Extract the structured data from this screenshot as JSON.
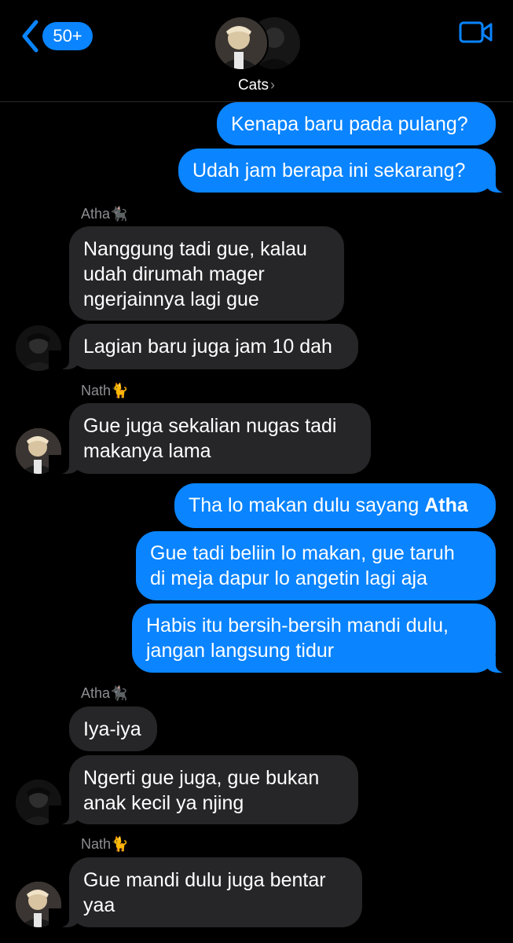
{
  "header": {
    "back_badge": "50+",
    "group_name": "Cats",
    "group_arrow": "›"
  },
  "messages": [
    {
      "type": "outgoing",
      "text": "Kenapa baru pada pulang?"
    },
    {
      "type": "outgoing",
      "text": "Udah jam berapa ini sekarang?"
    },
    {
      "type": "sender",
      "name": "Atha",
      "emoji": "🐈‍⬛"
    },
    {
      "type": "incoming",
      "lines": [
        "Nanggung tadi gue, kalau",
        "udah dirumah mager",
        "ngerjainnya lagi gue"
      ]
    },
    {
      "type": "incoming",
      "text": "Lagian baru juga jam 10 dah"
    },
    {
      "type": "sender",
      "name": "Nath",
      "emoji": "🐈"
    },
    {
      "type": "incoming",
      "lines": [
        "Gue juga sekalian nugas tadi",
        "makanya lama"
      ]
    },
    {
      "type": "outgoing",
      "text_before": "Tha lo makan dulu sayang ",
      "text_bold": "Atha"
    },
    {
      "type": "outgoing",
      "lines": [
        "Gue tadi beliin lo makan, gue taruh",
        "di meja dapur lo angetin lagi aja"
      ]
    },
    {
      "type": "outgoing",
      "lines": [
        "Habis itu bersih-bersih mandi dulu,",
        "jangan langsung tidur"
      ]
    },
    {
      "type": "sender",
      "name": "Atha",
      "emoji": "🐈‍⬛"
    },
    {
      "type": "incoming",
      "text": "Iya-iya"
    },
    {
      "type": "incoming",
      "lines": [
        "Ngerti gue juga, gue bukan",
        "anak kecil ya njing"
      ]
    },
    {
      "type": "sender",
      "name": "Nath",
      "emoji": "🐈"
    },
    {
      "type": "incoming",
      "lines": [
        "Gue mandi dulu juga bentar",
        "yaa"
      ]
    }
  ],
  "colors": {
    "outgoing_bubble": "#0a84ff",
    "incoming_bubble": "#262628",
    "background": "#000000",
    "sender_label": "#8e8e93"
  },
  "icons": {
    "back": "chevron-left-icon",
    "video": "video-camera-icon"
  }
}
